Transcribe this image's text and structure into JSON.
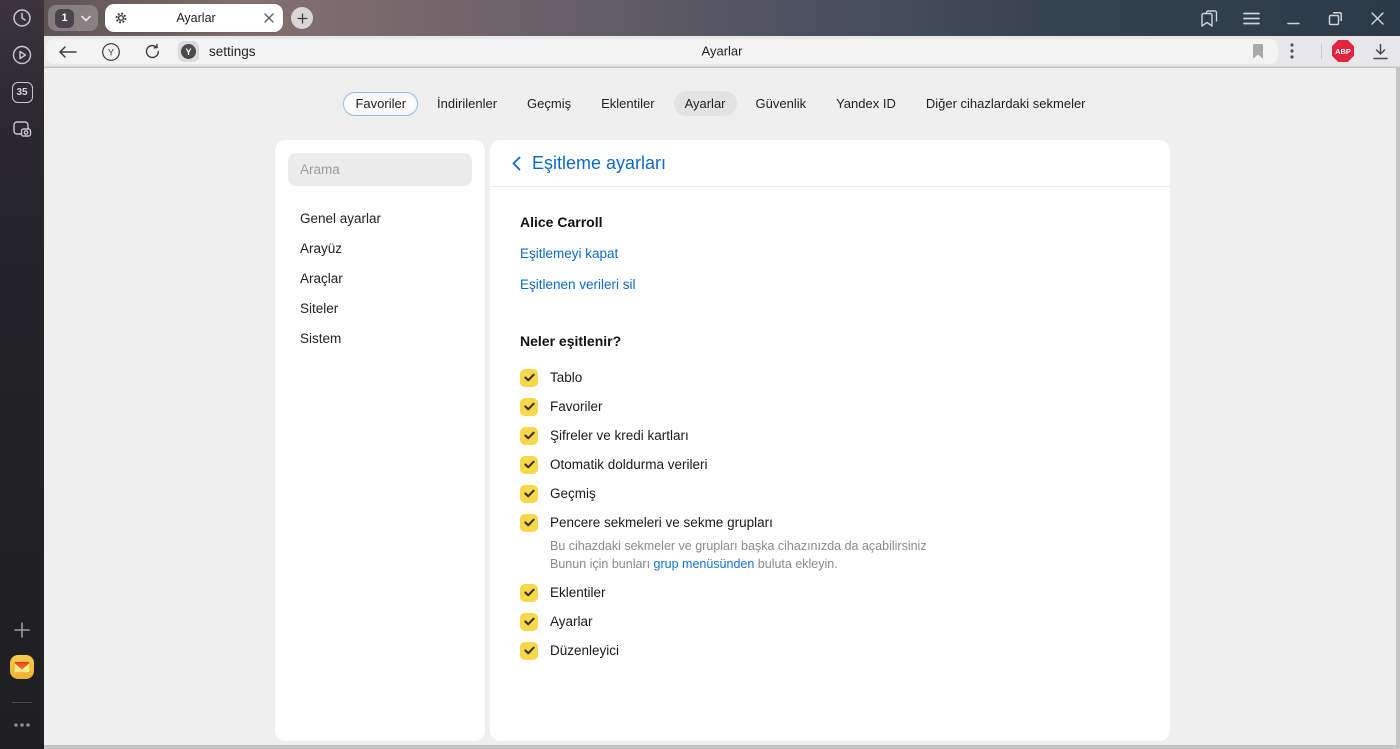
{
  "chrome": {
    "tab_group": {
      "count": "1"
    },
    "tab": {
      "title": "Ayarlar"
    },
    "rail": {
      "tab_counter": "35"
    }
  },
  "toolbar": {
    "url_text": "settings",
    "center_title": "Ayarlar",
    "favicon_letter": "Y",
    "home_letter": "Y",
    "abp_badge": "ABP"
  },
  "nav_tabs": [
    {
      "label": "Favoriler"
    },
    {
      "label": "İndirilenler"
    },
    {
      "label": "Geçmiş"
    },
    {
      "label": "Eklentiler"
    },
    {
      "label": "Ayarlar"
    },
    {
      "label": "Güvenlik"
    },
    {
      "label": "Yandex ID"
    },
    {
      "label": "Diğer cihazlardaki sekmeler"
    }
  ],
  "sidebar": {
    "search_placeholder": "Arama",
    "items": [
      {
        "label": "Genel ayarlar"
      },
      {
        "label": "Arayüz"
      },
      {
        "label": "Araçlar"
      },
      {
        "label": "Siteler"
      },
      {
        "label": "Sistem"
      }
    ]
  },
  "main": {
    "title": "Eşitleme ayarları",
    "account_name": "Alice Carroll",
    "link_disable_sync": "Eşitlemeyi kapat",
    "link_delete_synced": "Eşitlenen verileri sil",
    "section_title": "Neler eşitlenir?",
    "sync_items": [
      {
        "label": "Tablo",
        "checked": true
      },
      {
        "label": "Favoriler",
        "checked": true
      },
      {
        "label": "Şifreler ve kredi kartları",
        "checked": true
      },
      {
        "label": "Otomatik doldurma verileri",
        "checked": true
      },
      {
        "label": "Geçmiş",
        "checked": true
      },
      {
        "label": "Pencere sekmeleri ve sekme grupları",
        "checked": true,
        "description_line1": "Bu cihazdaki sekmeler ve grupları başka cihazınızda da açabilirsiniz",
        "description_line2_prefix": "Bunun için bunları ",
        "description_link": "grup menüsünden",
        "description_line2_suffix": " buluta ekleyin."
      },
      {
        "label": "Eklentiler",
        "checked": true
      },
      {
        "label": "Ayarlar",
        "checked": true
      },
      {
        "label": "Düzenleyici",
        "checked": true
      }
    ]
  },
  "colors": {
    "accent_blue": "#0d6bc8",
    "checkbox_yellow": "#f8d74b",
    "abp_red": "#e2253f",
    "active_pill_gray": "#e3e3e3",
    "favorites_pill_border": "#8fbbe8",
    "page_background": "#f0efef"
  },
  "icons": [
    "history-clock-icon",
    "play-circle-icon",
    "tab-counter-icon",
    "screenshot-icon",
    "plus-icon",
    "yandex-mail-icon",
    "more-dots-icon",
    "gear-icon",
    "close-icon",
    "chevron-down-icon",
    "new-tab-plus-icon",
    "panels-icon",
    "menu-icon",
    "minimize-icon",
    "restore-icon",
    "back-arrow-icon",
    "yandex-home-icon",
    "refresh-icon",
    "site-favicon",
    "bookmark-flag-icon",
    "kebab-icon",
    "abp-badge-icon",
    "download-icon",
    "back-chevron-icon",
    "checkbox-check-icon"
  ]
}
